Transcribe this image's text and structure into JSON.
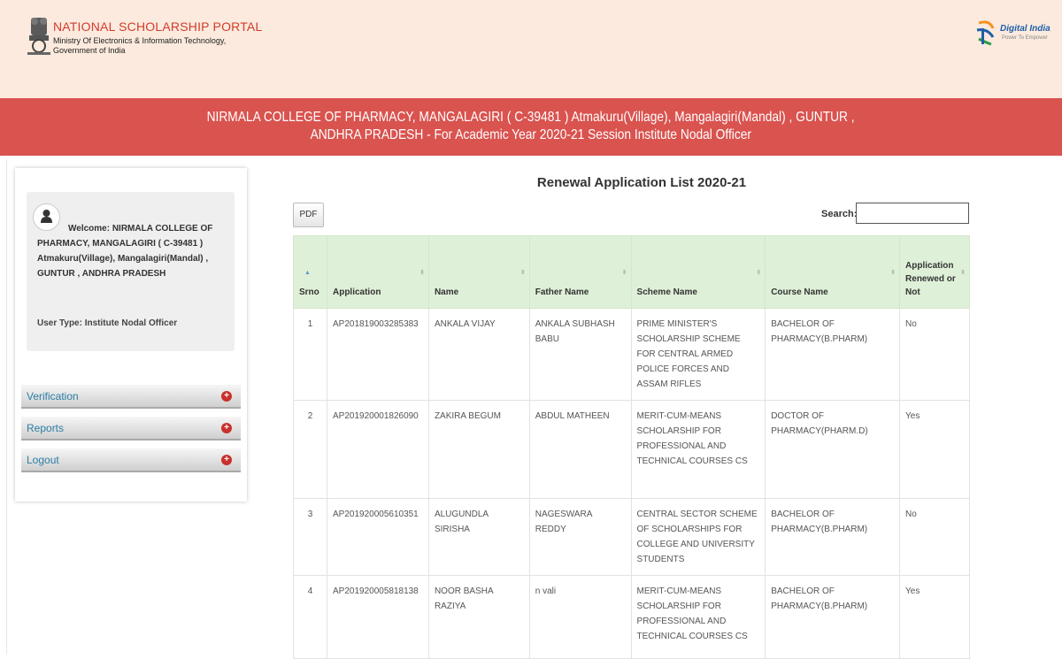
{
  "header": {
    "portal_title": "NATIONAL SCHOLARSHIP PORTAL",
    "ministry_line1": "Ministry Of Electronics & Information Technology,",
    "ministry_line2": "Government of India",
    "digital_india_text": "Digital India",
    "digital_india_tag": "Power To Empower"
  },
  "banner": {
    "line1": "NIRMALA COLLEGE OF PHARMACY, MANGALAGIRI ( C-39481 ) Atmakuru(Village), Mangalagiri(Mandal) , GUNTUR ,",
    "line2": "ANDHRA PRADESH - For Academic Year 2020-21 Session    Institute Nodal Officer"
  },
  "sidebar": {
    "welcome_line1": "Welcome: NIRMALA COLLEGE OF",
    "welcome_rest": "PHARMACY, MANGALAGIRI ( C-39481 ) Atmakuru(Village), Mangalagiri(Mandal) , GUNTUR , ANDHRA PRADESH",
    "user_type": "User Type:   Institute Nodal Officer",
    "menu": [
      {
        "label": "Verification"
      },
      {
        "label": "Reports"
      },
      {
        "label": "Logout"
      }
    ]
  },
  "main": {
    "title": "Renewal Application List 2020-21",
    "pdf_label": "PDF",
    "search_label": "Search:",
    "search_value": "",
    "columns": [
      "Srno",
      "Application",
      "Name",
      "Father Name",
      "Scheme Name",
      "Course Name",
      "Application Renewed or Not"
    ],
    "rows": [
      {
        "srno": "1",
        "application": "AP201819003285383",
        "name": "ANKALA VIJAY",
        "father": "ANKALA SUBHASH BABU",
        "scheme": "PRIME MINISTER'S SCHOLARSHIP SCHEME FOR CENTRAL ARMED POLICE FORCES AND ASSAM RIFLES",
        "course": "BACHELOR OF PHARMACY(B.PHARM)",
        "renewed": "No"
      },
      {
        "srno": "2",
        "application": "AP201920001826090",
        "name": "ZAKIRA BEGUM",
        "father": "ABDUL MATHEEN",
        "scheme": "MERIT-CUM-MEANS SCHOLARSHIP FOR PROFESSIONAL AND TECHNICAL COURSES CS",
        "course": "DOCTOR OF PHARMACY(PHARM.D)",
        "renewed": "Yes"
      },
      {
        "srno": "3",
        "application": "AP201920005610351",
        "name": "ALUGUNDLA SIRISHA",
        "father": "NAGESWARA REDDY",
        "scheme": "CENTRAL SECTOR SCHEME OF SCHOLARSHIPS FOR COLLEGE AND UNIVERSITY STUDENTS",
        "course": "BACHELOR OF PHARMACY(B.PHARM)",
        "renewed": "No"
      },
      {
        "srno": "4",
        "application": "AP201920005818138",
        "name": "NOOR BASHA RAZIYA",
        "father": "n vali",
        "scheme": "MERIT-CUM-MEANS SCHOLARSHIP FOR PROFESSIONAL AND TECHNICAL COURSES CS",
        "course": "BACHELOR OF PHARMACY(B.PHARM)",
        "renewed": "Yes"
      }
    ]
  }
}
